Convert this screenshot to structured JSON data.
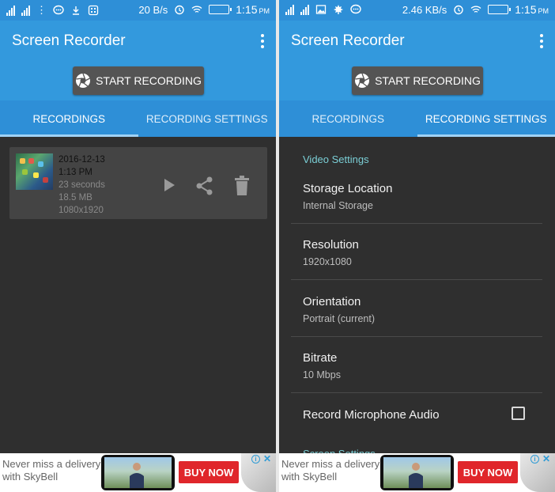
{
  "left": {
    "status": {
      "speed": "20 B/s",
      "time": "1:15",
      "ampm": "PM"
    },
    "app_title": "Screen Recorder",
    "start_button": "START RECORDING",
    "tabs": [
      {
        "label": "RECORDINGS",
        "active": true
      },
      {
        "label": "RECORDING SETTINGS",
        "active": false
      }
    ],
    "recording": {
      "date": "2016-12-13",
      "time": "1:13 PM",
      "duration": "23 seconds",
      "size": "18.5 MB",
      "resolution": "1080x1920"
    },
    "ad": {
      "line1": "Never miss a delivery",
      "line2": "with SkyBell",
      "button": "BUY NOW"
    }
  },
  "right": {
    "status": {
      "speed": "2.46 KB/s",
      "time": "1:15",
      "ampm": "PM"
    },
    "app_title": "Screen Recorder",
    "start_button": "START RECORDING",
    "tabs": [
      {
        "label": "RECORDINGS",
        "active": false
      },
      {
        "label": "RECORDING SETTINGS",
        "active": true
      }
    ],
    "section_heading": "Video Settings",
    "settings": [
      {
        "title": "Storage Location",
        "value": "Internal Storage"
      },
      {
        "title": "Resolution",
        "value": "1920x1080"
      },
      {
        "title": "Orientation",
        "value": "Portrait (current)"
      },
      {
        "title": "Bitrate",
        "value": "10 Mbps"
      },
      {
        "title": "Record Microphone Audio",
        "checked": false
      }
    ],
    "next_section_peek": "Screen Settings",
    "ad": {
      "line1": "Never miss a delivery",
      "line2": "with SkyBell",
      "button": "BUY NOW"
    }
  },
  "colors": {
    "status_bar": "#2e8fd7",
    "app_bar": "#3399dd",
    "background": "#2f2f2f",
    "accent": "#7bcfd6",
    "buy_button": "#e0262b"
  }
}
